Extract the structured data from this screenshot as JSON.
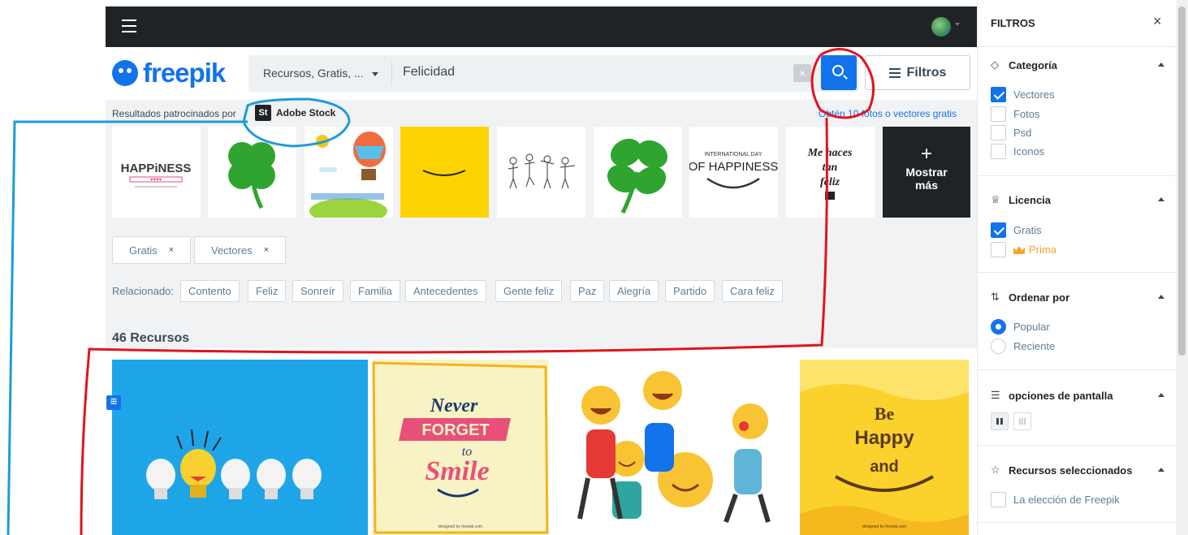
{
  "header": {
    "logo_text": "freepik",
    "search_type": "Recursos, Gratis, ...",
    "search_value": "Felicidad",
    "clear_label": "×",
    "filters_button": "Filtros"
  },
  "sponsored": {
    "label": "Resultados patrocinados por",
    "partner_mark": "St",
    "partner_name": "Adobe Stock",
    "free_link": "Obtén 10 fotos o vectores gratis",
    "show_more_plus": "+",
    "show_more_label": "Mostrar más"
  },
  "thumbnails": {
    "happiness": "HAPPiNESS",
    "international_day": "INTERNATIONAL DAY",
    "of_happiness": "OF HAPPINESS",
    "me_haces": "Me haces",
    "tan": "tan",
    "feliz": "feliz"
  },
  "active_filters": [
    {
      "label": "Gratis",
      "remove": "×"
    },
    {
      "label": "Vectores",
      "remove": "×"
    }
  ],
  "related": {
    "label": "Relacionado:",
    "items": [
      "Contento",
      "Feliz",
      "Sonreír",
      "Familia",
      "Antecedentes",
      "Gente feliz",
      "Paz",
      "Alegría",
      "Partido",
      "Cara feliz"
    ]
  },
  "results": {
    "count": "46 Recursos",
    "card2_never": "Never",
    "card2_forget": "FORGET",
    "card2_to": "to",
    "card2_smile": "Smile",
    "card4_be": "Be",
    "card4_happy": "Happy",
    "card4_and": "and",
    "designed_by": "designed by freepik.com"
  },
  "sidebar": {
    "title": "FILTROS",
    "close": "×",
    "categoria": {
      "title": "Categoría",
      "options": [
        "Vectores",
        "Fotos",
        "Psd",
        "Iconos"
      ]
    },
    "licencia": {
      "title": "Licencia",
      "options": [
        "Gratis",
        "Prima"
      ]
    },
    "ordenar": {
      "title": "Ordenar por",
      "options": [
        "Popular",
        "Reciente"
      ]
    },
    "pantalla": {
      "title": "opciones de pantalla"
    },
    "seleccionados": {
      "title": "Recursos seleccionados",
      "options": [
        "La elección de Freepik"
      ]
    }
  },
  "colors": {
    "brand_blue": "#1273eb",
    "dark_bar": "#1f2326",
    "annotation_red": "#e0141e",
    "annotation_blue": "#1e9bd7",
    "annotation_orange": "#f5b21e"
  }
}
